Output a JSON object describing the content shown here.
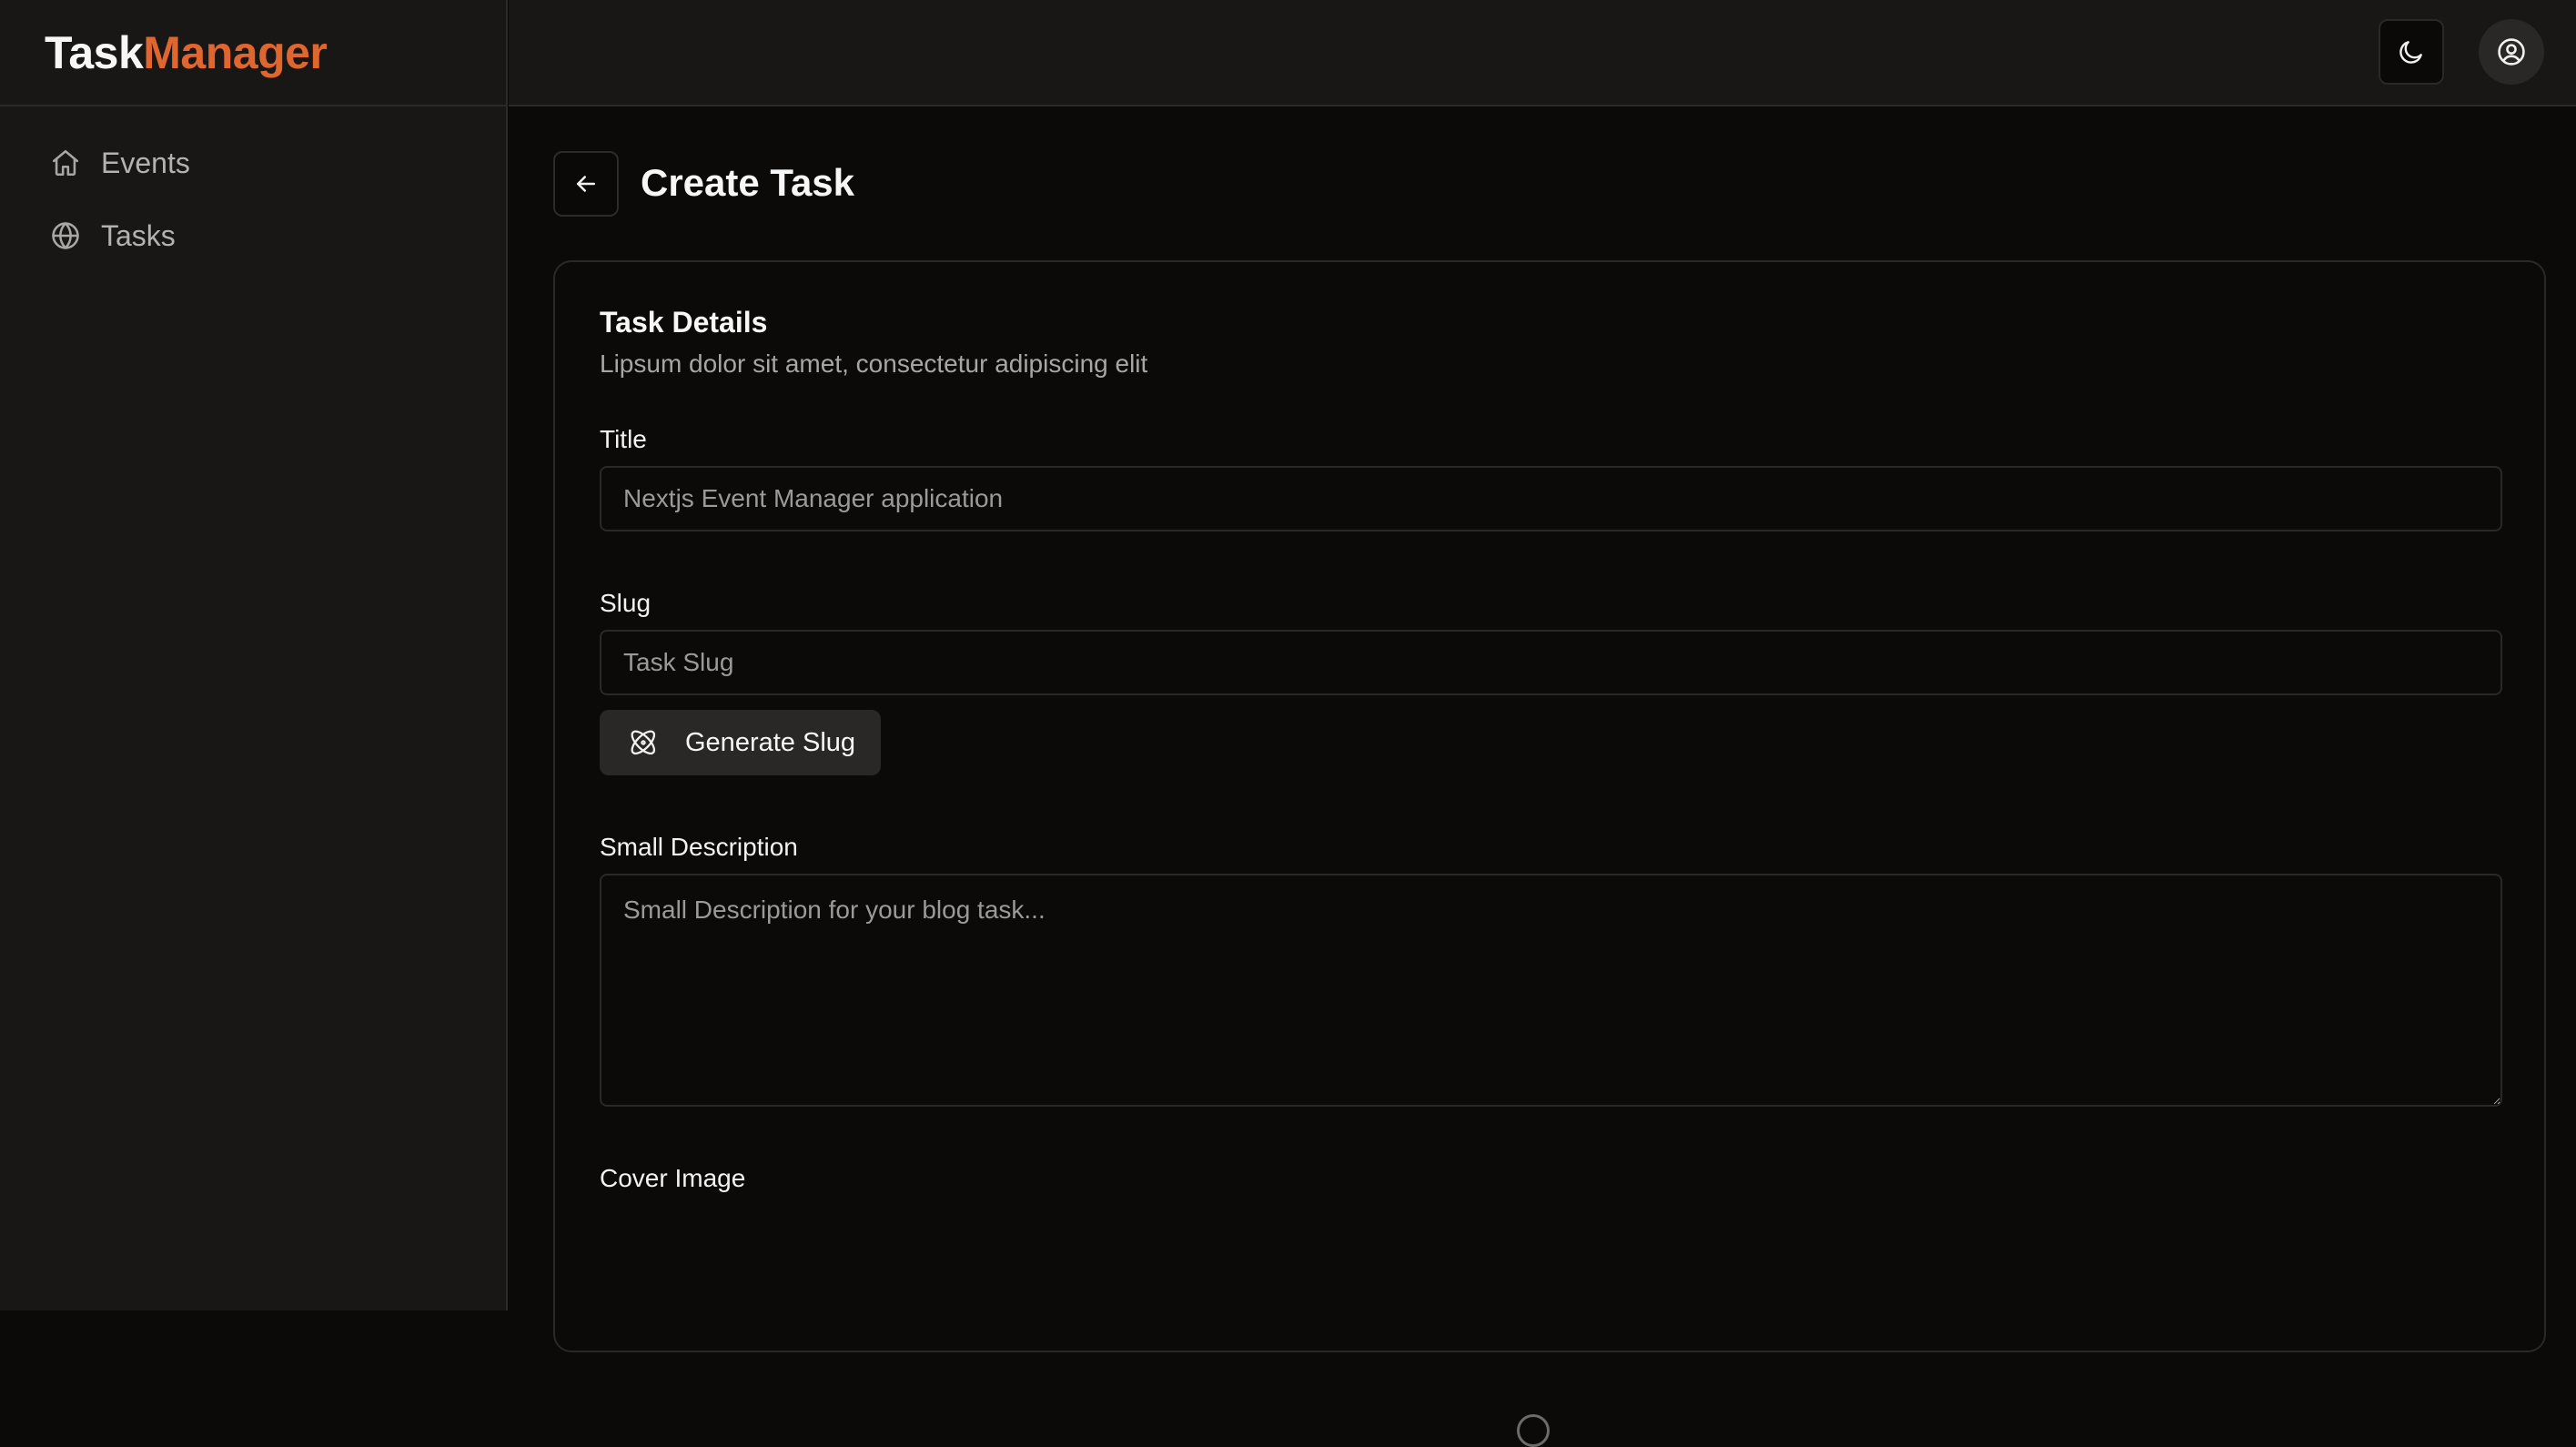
{
  "brand": {
    "part1": "Task",
    "part2": "Manager",
    "part1_color": "#f7f7f7",
    "part2_color": "#e0662f"
  },
  "sidebar": {
    "items": [
      {
        "label": "Events",
        "icon": "home-icon"
      },
      {
        "label": "Tasks",
        "icon": "globe-icon"
      }
    ]
  },
  "header": {
    "theme_toggle_icon": "moon-icon",
    "user_icon": "user-circle-icon"
  },
  "page": {
    "title": "Create Task",
    "back_icon": "arrow-left-icon"
  },
  "card": {
    "title": "Task Details",
    "description": "Lipsum dolor sit amet, consectetur adipiscing elit"
  },
  "form": {
    "title_label": "Title",
    "title_placeholder": "Nextjs Event Manager application",
    "slug_label": "Slug",
    "slug_placeholder": "Task Slug",
    "generate_slug_label": "Generate Slug",
    "generate_slug_icon": "atom-icon",
    "small_description_label": "Small Description",
    "small_description_placeholder": "Small Description for your blog task...",
    "cover_image_label": "Cover Image"
  },
  "colors": {
    "accent": "#e0662f",
    "background": "#0b0a09",
    "sidebar_bg": "#181716"
  }
}
